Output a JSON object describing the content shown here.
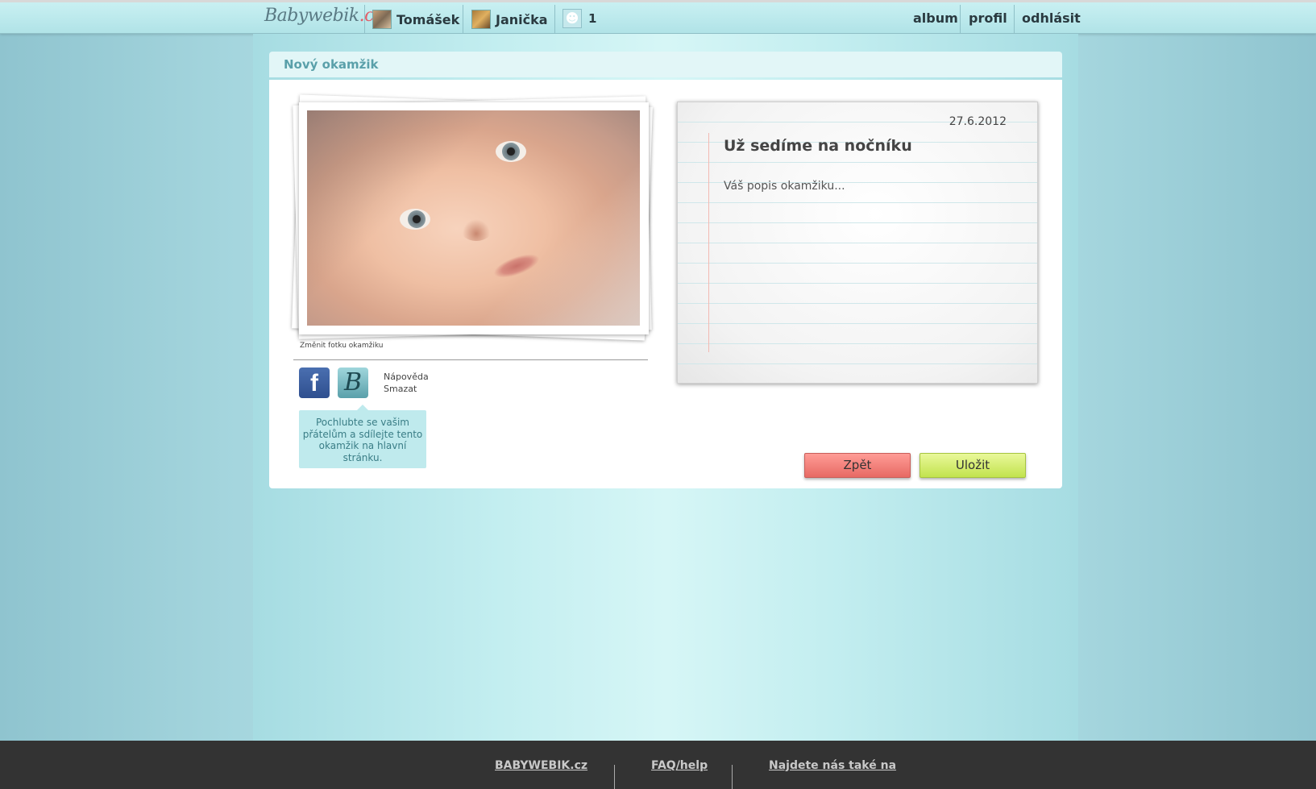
{
  "header": {
    "logo": "Babywebik",
    "logo_suffix": ".cz",
    "children": [
      {
        "name": "Tomášek"
      },
      {
        "name": "Janička"
      }
    ],
    "add_child_count": "1",
    "nav": {
      "album": "album",
      "profile": "profil",
      "logout": "odhlásit"
    }
  },
  "main": {
    "section_title": "Nový okamžik",
    "photo": {
      "change_label": "Změnit fotku okamžiku"
    },
    "side_links": {
      "help": "Nápověda",
      "delete": "Smazat"
    },
    "tooltip": "Pochlubte se vašim přátelům a sdílejte tento okamžik na hlavní stránku.",
    "note": {
      "date": "27.6.2012",
      "title": "Už sedíme na nočníku",
      "description": "Váš popis okamžiku..."
    },
    "buttons": {
      "back": "Zpět",
      "save": "Uložit"
    }
  },
  "footer": {
    "links": [
      "BABYWEBIK.cz",
      "FAQ/help",
      "Najdete nás také na"
    ]
  },
  "icons": {
    "facebook": "facebook-icon",
    "babywebik": "babywebik-b-icon",
    "add_child": "baby-silhouette-icon"
  }
}
